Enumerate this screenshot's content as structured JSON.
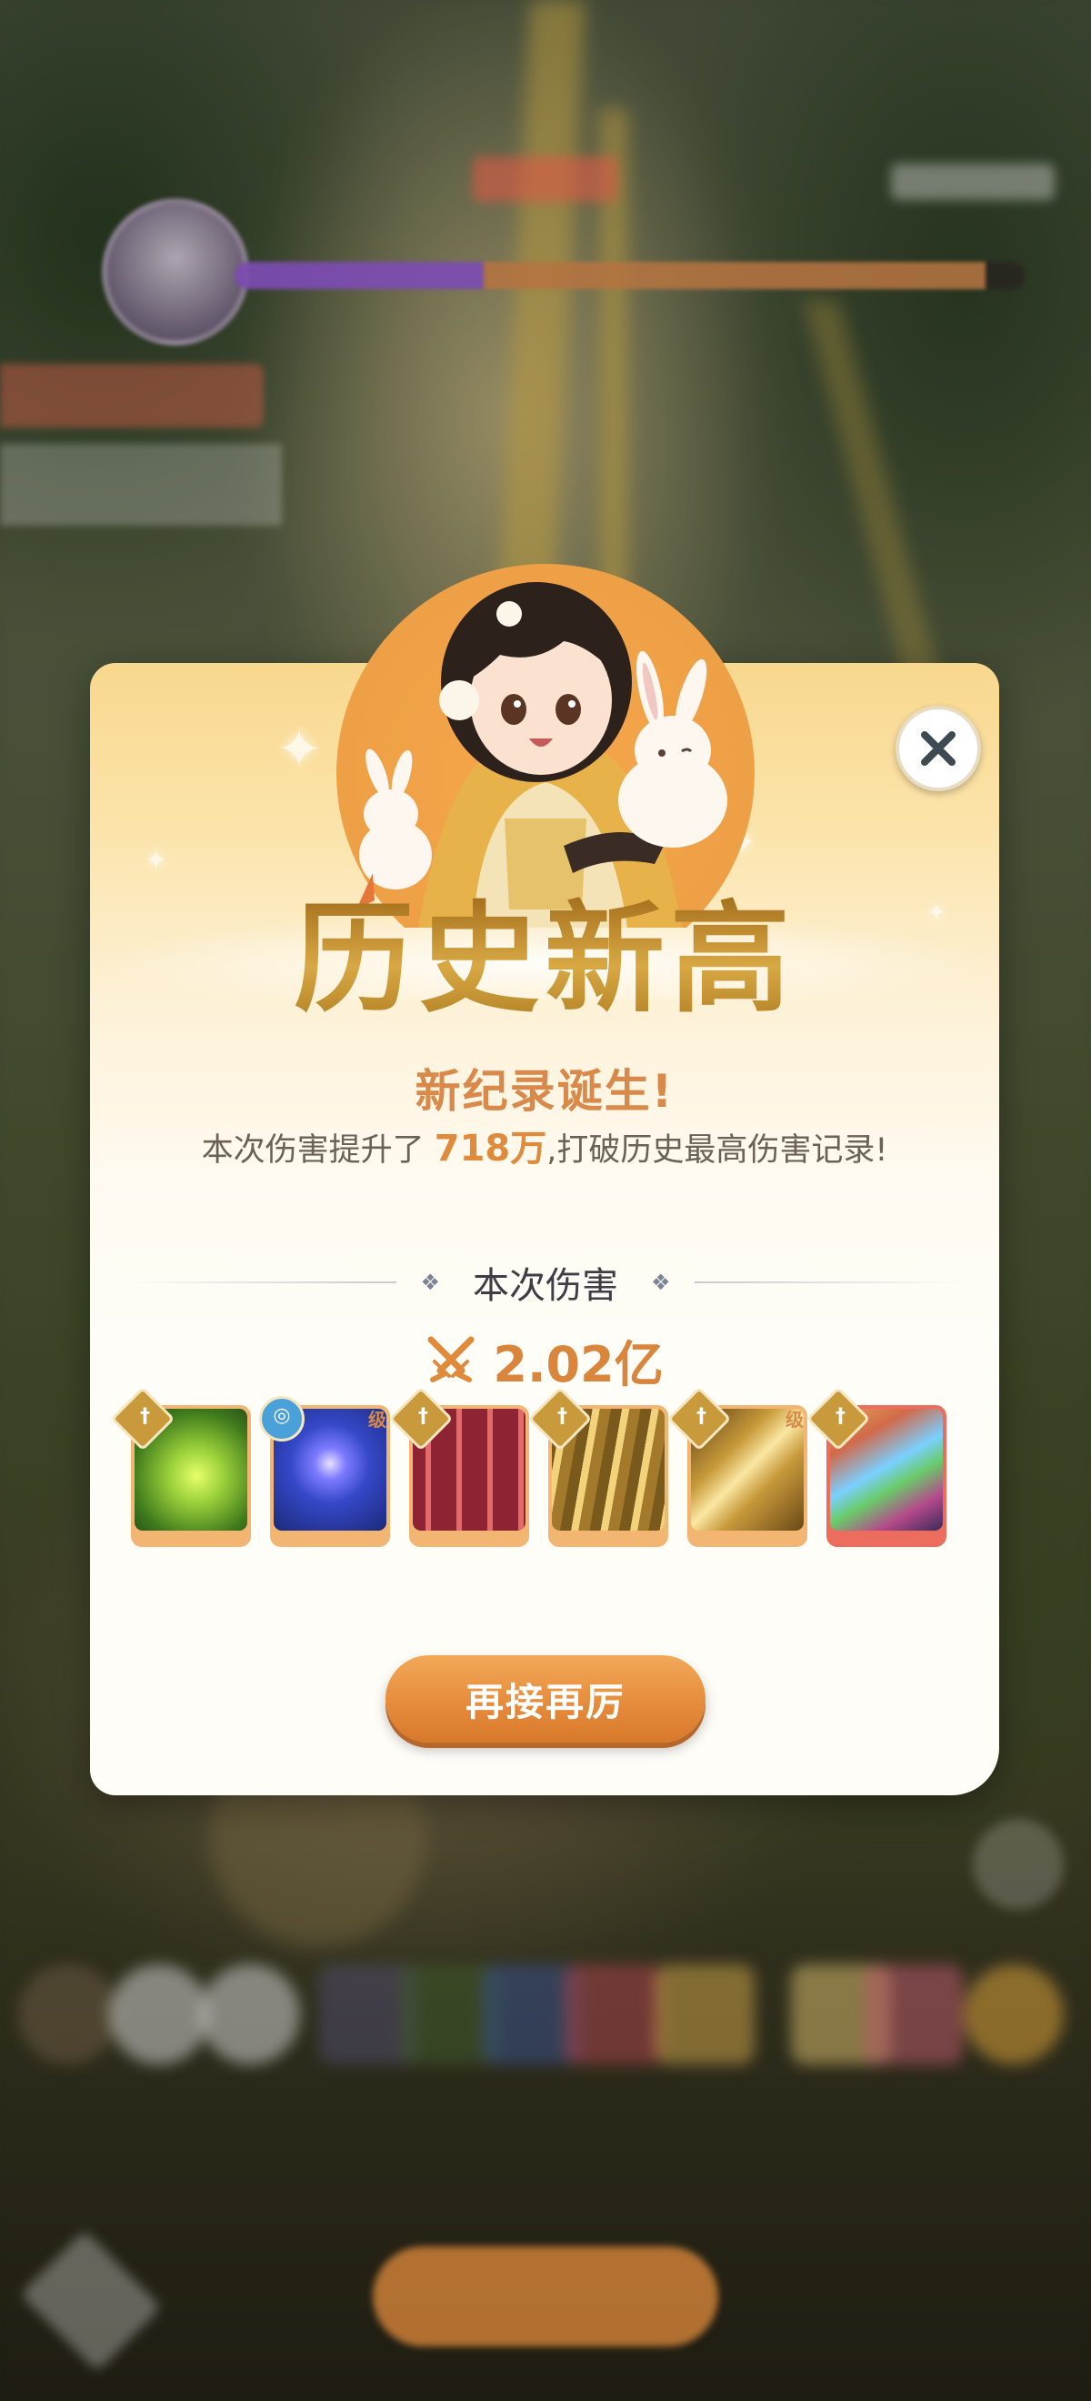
{
  "popup": {
    "title": "历史新高",
    "subtitle": "新纪录诞生!",
    "desc_prefix": "本次伤害提升了 ",
    "desc_value": "718万",
    "desc_suffix": ",打破历史最高伤害记录!",
    "section_label": "本次伤害",
    "damage_value": "2.02亿",
    "retry_label": "再接再厉"
  },
  "skills": [
    {
      "name": "green-slash",
      "badge": "sword",
      "tag": ""
    },
    {
      "name": "blue-orb",
      "badge": "swirl",
      "tag": "级"
    },
    {
      "name": "red-swords",
      "badge": "sword",
      "tag": ""
    },
    {
      "name": "gold-blades",
      "badge": "sword",
      "tag": ""
    },
    {
      "name": "gold-shard",
      "badge": "sword",
      "tag": "级"
    },
    {
      "name": "rainbow-streak",
      "badge": "sword",
      "tag": ""
    }
  ],
  "background": {
    "boss_hp_fraction": 0.67,
    "boss_hp_lost_fraction": 0.95
  },
  "colors": {
    "accent_orange": "#e48a3a",
    "title_gold": "#c9972e",
    "highlight": "#e08a3c"
  },
  "icons": {
    "close": "close-icon",
    "damage": "crossed-swords-icon"
  }
}
